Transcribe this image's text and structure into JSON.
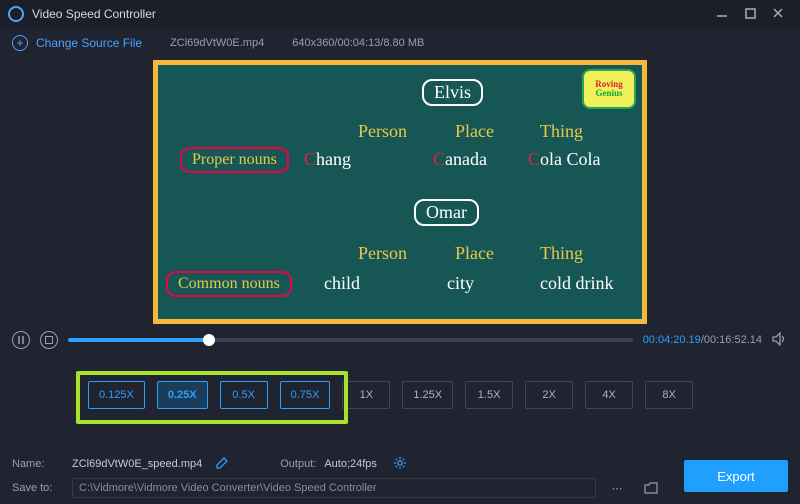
{
  "titlebar": {
    "title": "Video Speed Controller"
  },
  "filebar": {
    "change_label": "Change Source File",
    "filename": "ZCl69dVtW0E.mp4",
    "meta": "640x360/00:04:13/8.80 MB"
  },
  "video": {
    "badge_top": "Roving",
    "badge_bottom": "Genius",
    "name1": "Elvis",
    "name2": "Omar",
    "hdr_person": "Person",
    "hdr_place": "Place",
    "hdr_thing": "Thing",
    "proper_label": "Proper nouns",
    "common_label": "Common nouns",
    "r1c1": "Chang",
    "r1c2": "Canada",
    "r1c3": "Cola Cola",
    "r2c1": "child",
    "r2c2": "city",
    "r2c3": "cold drink"
  },
  "playback": {
    "current": "00:04:20.19",
    "total": "00:16:52.14"
  },
  "speeds": {
    "s0": "0.125X",
    "s1": "0.25X",
    "s2": "0.5X",
    "s3": "0.75X",
    "s4": "1X",
    "s5": "1.25X",
    "s6": "1.5X",
    "s7": "2X",
    "s8": "4X",
    "s9": "8X"
  },
  "bottom": {
    "name_label": "Name:",
    "name_value": "ZCl69dVtW0E_speed.mp4",
    "output_label": "Output:",
    "output_value": "Auto;24fps",
    "save_label": "Save to:",
    "save_path": "C:\\Vidmore\\Vidmore Video Converter\\Video Speed Controller",
    "export": "Export"
  }
}
